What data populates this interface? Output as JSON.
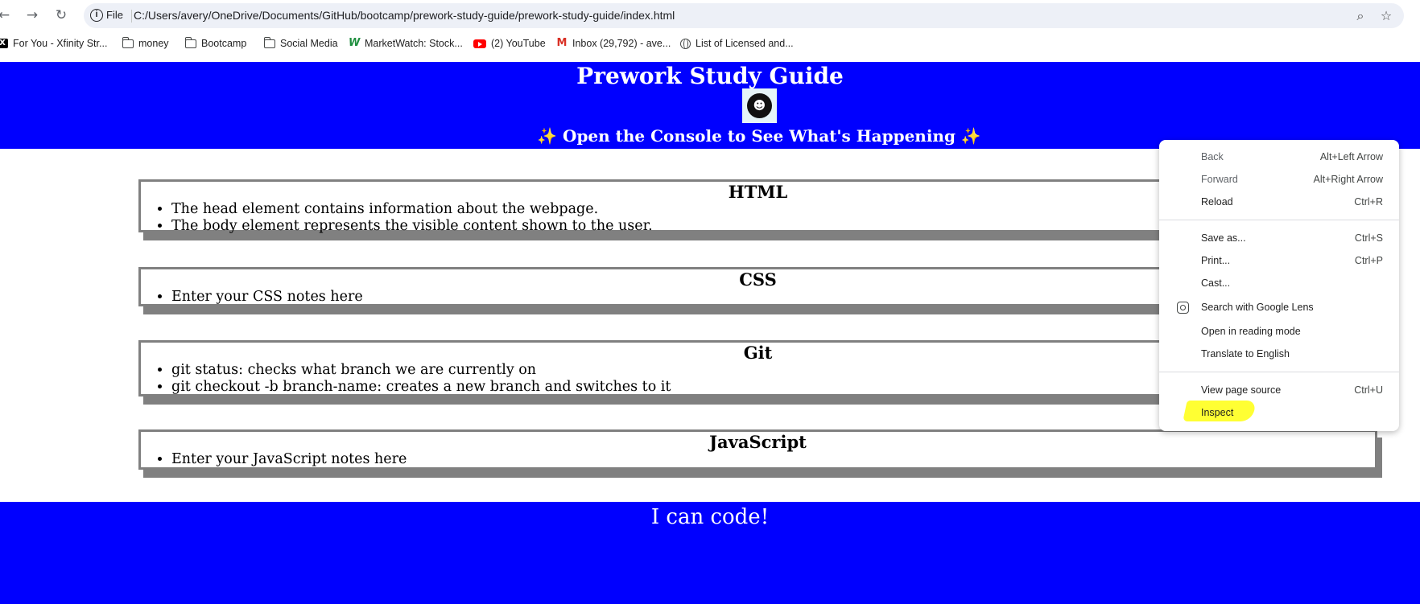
{
  "browser": {
    "file_label": "File",
    "url": "C:/Users/avery/OneDrive/Documents/GitHub/bootcamp/prework-study-guide/prework-study-guide/index.html",
    "bookmarks": [
      {
        "label": "For You - Xfinity Str...",
        "icon": "x-icon"
      },
      {
        "label": "money",
        "icon": "folder-icon"
      },
      {
        "label": "Bootcamp",
        "icon": "folder-icon"
      },
      {
        "label": "Social Media",
        "icon": "folder-icon"
      },
      {
        "label": "MarketWatch: Stock...",
        "icon": "marketwatch-icon"
      },
      {
        "label": "(2) YouTube",
        "icon": "youtube-icon"
      },
      {
        "label": "Inbox (29,792) - ave...",
        "icon": "gmail-icon"
      },
      {
        "label": "List of Licensed and...",
        "icon": "globe-icon"
      }
    ]
  },
  "page": {
    "title": "Prework Study Guide",
    "subtitle": "✨ Open the Console to See What's Happening ✨",
    "sections": [
      {
        "title": "HTML",
        "items": [
          "The head element contains information about the webpage.",
          "The body element represents the visible content shown to the user."
        ]
      },
      {
        "title": "CSS",
        "items": [
          "Enter your CSS notes here"
        ]
      },
      {
        "title": "Git",
        "items": [
          "git status: checks what branch we are currently on",
          "git checkout -b branch-name: creates a new branch and switches to it"
        ]
      },
      {
        "title": "JavaScript",
        "items": [
          "Enter your JavaScript notes here"
        ]
      }
    ],
    "footer": "I can code!"
  },
  "context_menu": {
    "items": [
      {
        "label": "Back",
        "shortcut": "Alt+Left Arrow"
      },
      {
        "label": "Forward",
        "shortcut": "Alt+Right Arrow"
      },
      {
        "label": "Reload",
        "shortcut": "Ctrl+R"
      },
      {
        "label": "Save as...",
        "shortcut": "Ctrl+S"
      },
      {
        "label": "Print...",
        "shortcut": "Ctrl+P"
      },
      {
        "label": "Cast...",
        "shortcut": ""
      },
      {
        "label": "Search with Google Lens",
        "shortcut": ""
      },
      {
        "label": "Open in reading mode",
        "shortcut": ""
      },
      {
        "label": "Translate to English",
        "shortcut": ""
      },
      {
        "label": "View page source",
        "shortcut": "Ctrl+U"
      },
      {
        "label": "Inspect",
        "shortcut": ""
      }
    ],
    "highlight_color": "#ffff33"
  },
  "colors": {
    "header_bg": "#0000ff",
    "card_border": "#808080",
    "header_text": "#ffffff"
  }
}
